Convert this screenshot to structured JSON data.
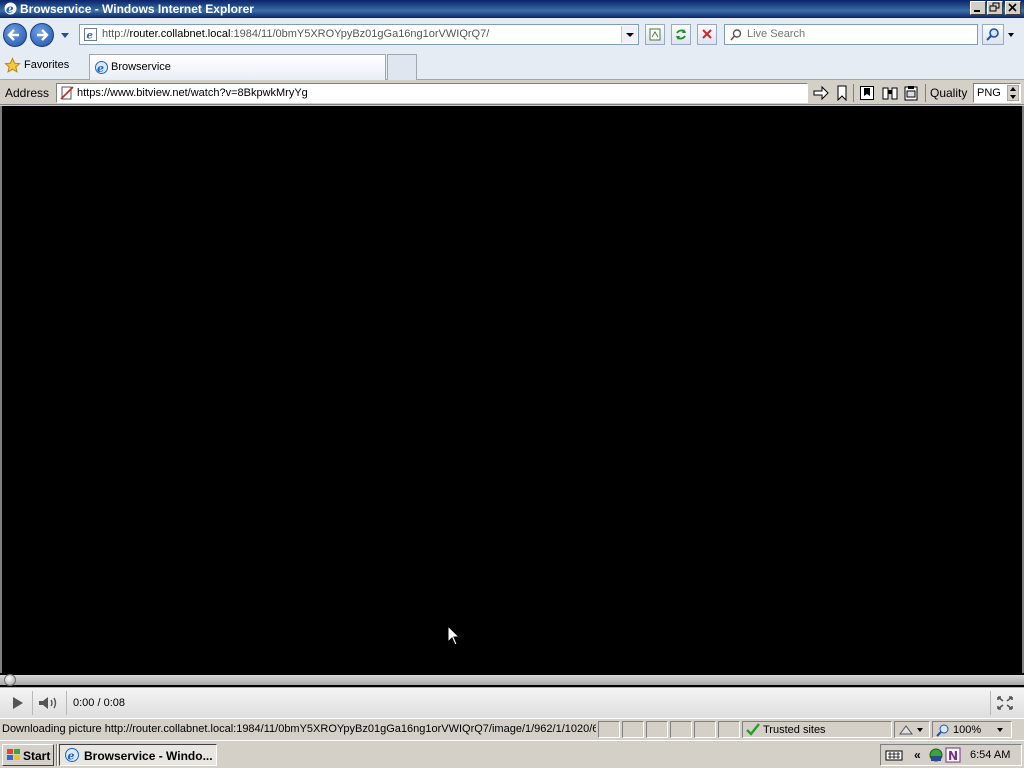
{
  "window": {
    "title": "Browservice - Windows Internet Explorer"
  },
  "ie_toolbar": {
    "url": "http://router.collabnet.local:1984/11/0bmY5XROYpyBz01gGa16ng1orVWIQrQ7/",
    "url_host": "router.collabnet.local",
    "url_prefix": "http://",
    "url_suffix": ":1984/11/0bmY5XROYpyBz01gGa16ng1orVWIQrQ7/",
    "search_placeholder": "Live Search"
  },
  "favorites_bar": {
    "favorites_label": "Favorites",
    "tabs": [
      {
        "label": "Browservice",
        "active": true
      }
    ]
  },
  "browservice_toolbar": {
    "address_label": "Address",
    "address_value": "https://www.bitview.net/watch?v=8BkpwkMryYg",
    "quality_label": "Quality",
    "quality_value": "PNG"
  },
  "player": {
    "time_display": "0:00 / 0:08",
    "progress": 0.0
  },
  "status_bar": {
    "message": "Downloading picture http://router.collabnet.local:1984/11/0bmY5XROYpyBz01gGa16ng1orVWIQrQ7/image/1/962/1/1020/6",
    "zone": "Trusted sites",
    "zoom": "100%"
  },
  "taskbar": {
    "start_label": "Start",
    "task_label": "Browservice - Windo...",
    "clock": "6:54 AM"
  },
  "colors": {
    "titlebar": "#0a246a",
    "content_background": "#000000",
    "system_gray": "#d4d0c8"
  }
}
